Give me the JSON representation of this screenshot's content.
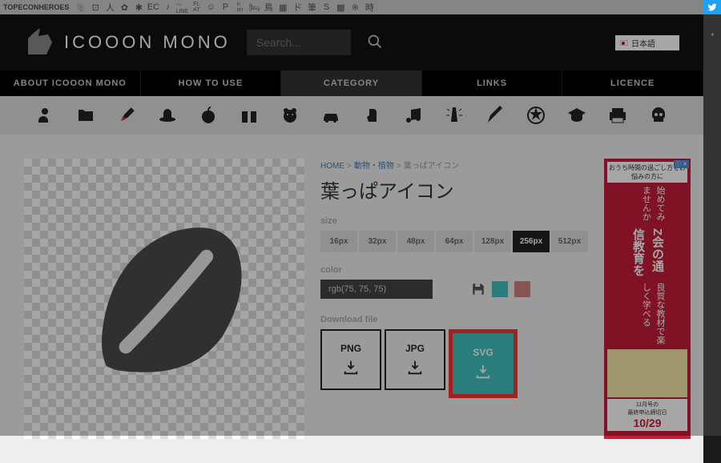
{
  "topbar": {
    "brand": "TOPECONHEROES"
  },
  "header": {
    "logo": "ICOOON MONO",
    "search_placeholder": "Search...",
    "lang": "日本語"
  },
  "nav": {
    "items": [
      "ABOUT ICOOON MONO",
      "HOW TO USE",
      "CATEGORY",
      "LINKS",
      "LICENCE"
    ],
    "active": 2
  },
  "crumb": {
    "home": "HOME",
    "cat": "動物・植物",
    "cur": "葉っぱアイコン"
  },
  "title": "葉っぱアイコン",
  "labels": {
    "size": "size",
    "color": "color",
    "download": "Download file"
  },
  "sizes": [
    "16px",
    "32px",
    "48px",
    "64px",
    "128px",
    "256px",
    "512px"
  ],
  "size_active": 5,
  "color_value": "rgb(75, 75, 75)",
  "swatches": [
    "#3fc1bf",
    "#d08080"
  ],
  "downloads": [
    "PNG",
    "JPG",
    "SVG"
  ],
  "ad": {
    "top": "おうち時間の過ごし方をお悩みの方に",
    "line1": "始めてみませんか",
    "line2": "Z会の通信教育を",
    "line3": "良質な教材で楽しく学べる",
    "foot1": "11月号の",
    "foot2": "最終申込締切日",
    "date": "10/29",
    "x": "ⓘ ✕"
  }
}
